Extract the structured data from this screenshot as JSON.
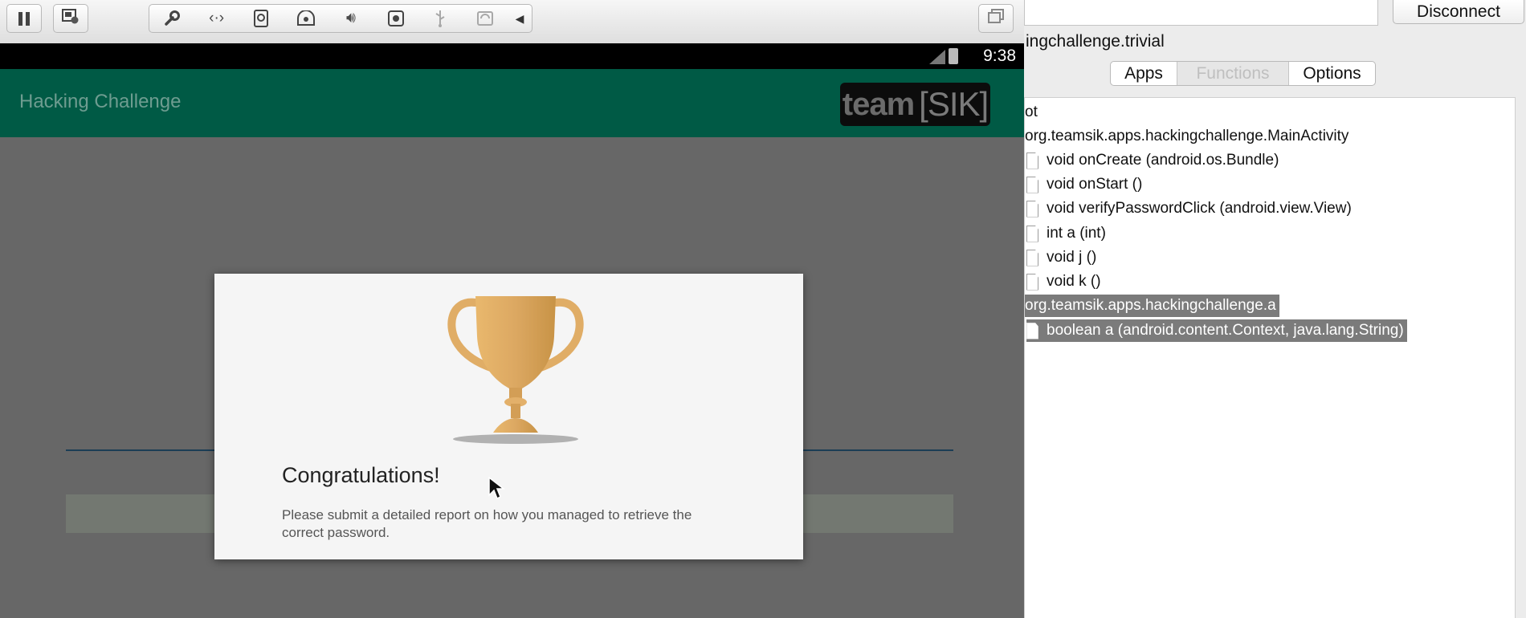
{
  "emulator": {
    "toolbar": {
      "pause_icon": "pause-icon",
      "snapshot_icon": "snapshot-icon",
      "icons": [
        "wrench-icon",
        "network-icon",
        "hard-disk-icon",
        "optical-drive-icon",
        "audio-icon",
        "camera-icon",
        "usb-icon",
        "shared-folder-icon"
      ],
      "collapse_icon": "collapse-arrow-icon",
      "window_icon": "window-mode-icon"
    },
    "status_bar": {
      "time": "9:38"
    },
    "app_bar": {
      "title": "Hacking Challenge",
      "logo_text": "team",
      "logo_bracket": "[SIK]"
    },
    "dialog": {
      "title": "Congratulations!",
      "message": "Please submit a detailed report on how you managed to retrieve the correct password."
    }
  },
  "tool": {
    "disconnect_label": "Disconnect",
    "package": "ingchallenge.trivial",
    "tabs": [
      "Apps",
      "Functions",
      "Options"
    ],
    "tree": {
      "root": "ot",
      "class1": "org.teamsik.apps.hackingchallenge.MainActivity",
      "class1_methods": [
        "void onCreate (android.os.Bundle)",
        "void onStart ()",
        "void verifyPasswordClick (android.view.View)",
        "int a (int)",
        "void j ()",
        "void k ()"
      ],
      "class2": "org.teamsik.apps.hackingchallenge.a",
      "class2_methods": [
        "boolean a (android.content.Context, java.lang.String)"
      ]
    }
  }
}
